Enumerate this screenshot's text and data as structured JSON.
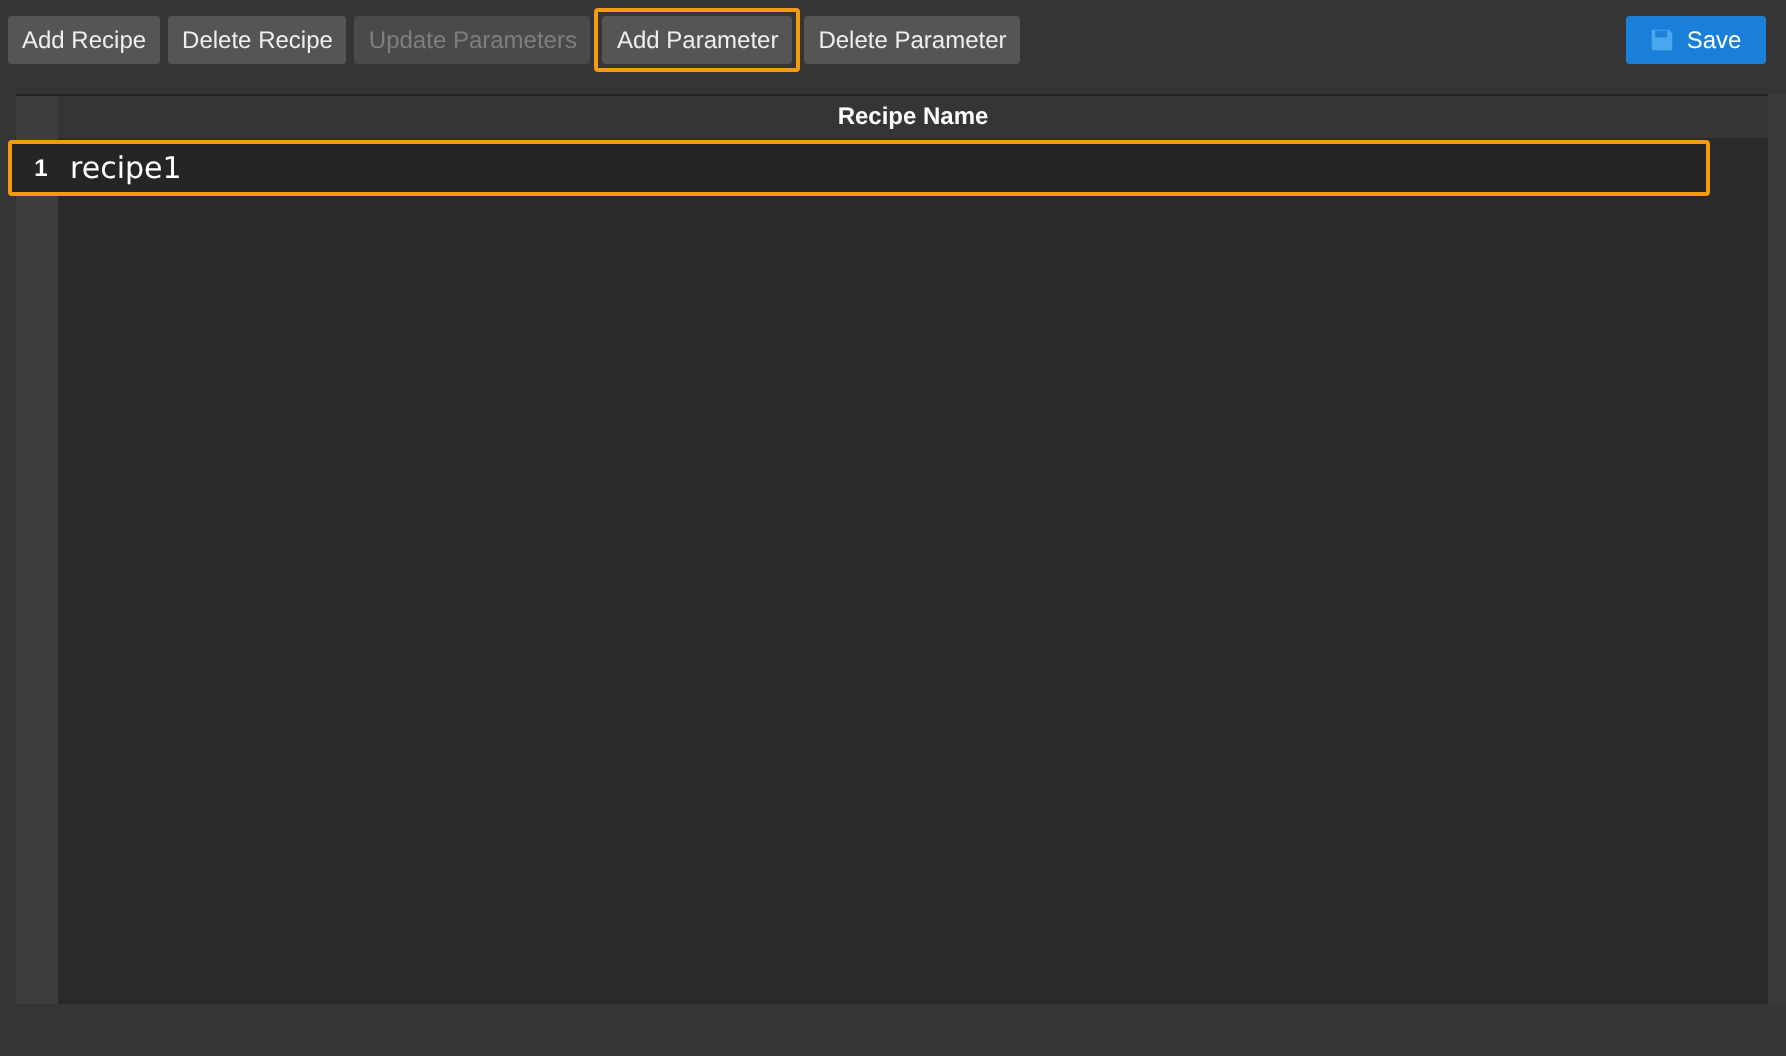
{
  "toolbar": {
    "buttons": [
      {
        "label": "Add Recipe",
        "disabled": false,
        "highlighted": false
      },
      {
        "label": "Delete Recipe",
        "disabled": false,
        "highlighted": false
      },
      {
        "label": "Update Parameters",
        "disabled": true,
        "highlighted": false
      },
      {
        "label": "Add Parameter",
        "disabled": false,
        "highlighted": true
      },
      {
        "label": "Delete Parameter",
        "disabled": false,
        "highlighted": false
      }
    ],
    "save_button": {
      "label": "Save"
    }
  },
  "table": {
    "columns": [
      "Recipe Name"
    ],
    "rows": [
      {
        "index": "1",
        "name": "recipe1",
        "highlighted": true
      }
    ]
  }
}
